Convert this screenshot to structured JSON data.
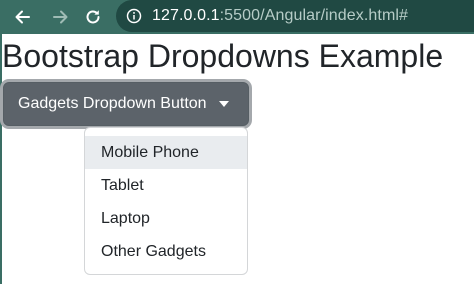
{
  "browser": {
    "url_host": "127.0.0.1",
    "url_rest": ":5500/Angular/index.html#",
    "icons": [
      "back-arrow-icon",
      "forward-arrow-icon",
      "reload-icon",
      "info-icon"
    ]
  },
  "page": {
    "title": "Bootstrap Dropdowns Example"
  },
  "dropdown": {
    "button_label": "Gadgets Dropdown Button",
    "items": [
      {
        "label": "Mobile Phone",
        "highlighted": true
      },
      {
        "label": "Tablet",
        "highlighted": false
      },
      {
        "label": "Laptop",
        "highlighted": false
      },
      {
        "label": "Other Gadgets",
        "highlighted": false
      }
    ]
  },
  "colors": {
    "toolbar": "#3a6e64",
    "omnibox": "#204943",
    "button": "#5c636a",
    "menu_highlight": "#e9ecef"
  }
}
